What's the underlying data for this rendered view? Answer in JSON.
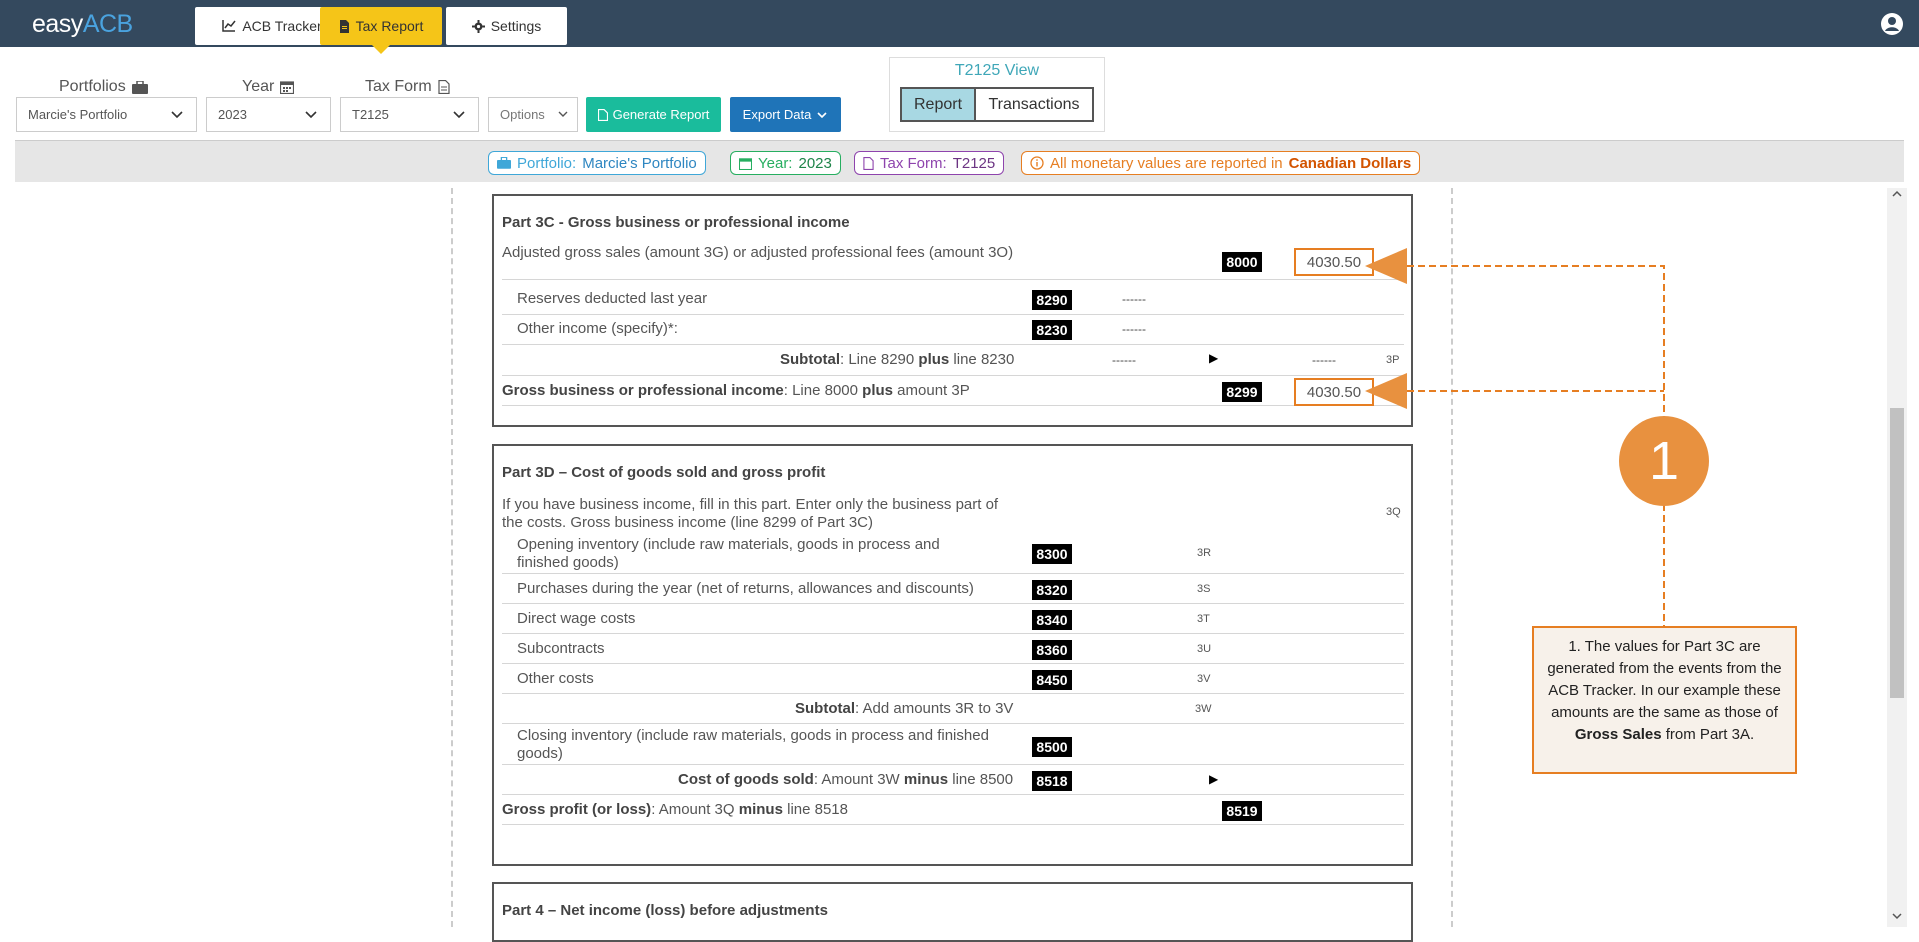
{
  "app": {
    "logo_easy": "easy",
    "logo_acb": "ACB"
  },
  "nav": {
    "tabs": [
      {
        "label": "ACB Tracker",
        "icon": "chart-line-icon"
      },
      {
        "label": "Tax Report",
        "icon": "document-icon",
        "active": true
      },
      {
        "label": "Settings",
        "icon": "gear-icon"
      }
    ]
  },
  "filters": {
    "portfolios_label": "Portfolios",
    "year_label": "Year",
    "taxform_label": "Tax Form",
    "portfolio_value": "Marcie's Portfolio",
    "year_value": "2023",
    "taxform_value": "T2125",
    "options_label": "Options",
    "generate_label": "Generate Report",
    "export_label": "Export Data"
  },
  "view": {
    "title": "T2125 View",
    "report_label": "Report",
    "transactions_label": "Transactions",
    "active": "Report"
  },
  "chips": {
    "portfolio_prefix": "Portfolio:",
    "portfolio_value": "Marcie's Portfolio",
    "year_prefix": "Year:",
    "year_value": "2023",
    "taxform_prefix": "Tax Form:",
    "taxform_value": "T2125",
    "currency_text": "All monetary values are reported in",
    "currency_value": "Canadian Dollars"
  },
  "part3c": {
    "title": "Part 3C - Gross business or professional income",
    "adj_text": "Adjusted gross sales (amount 3G) or adjusted professional fees (amount 3O)",
    "adj_code": "8000",
    "adj_value": "4030.50",
    "reserves_text": "Reserves deducted last year",
    "reserves_code": "8290",
    "reserves_val": "------",
    "other_text": "Other income (specify)*:",
    "other_code": "8230",
    "other_val": "------",
    "subtotal_bold": "Subtotal",
    "subtotal_text1": ": Line 8290",
    "subtotal_plus": "plus",
    "subtotal_text2": "line 8230",
    "subtotal_val1": "------",
    "subtotal_val2": "------",
    "subtotal_amt": "3P",
    "gross_bold": "Gross business or professional income",
    "gross_text1": ": Line 8000",
    "gross_plus": "plus",
    "gross_text2": "amount 3P",
    "gross_code": "8299",
    "gross_value": "4030.50"
  },
  "part3d": {
    "title": "Part 3D – Cost of goods sold and gross profit",
    "intro_text": "If you have business income, fill in this part. Enter only the business part of the costs. Gross business income (line 8299 of Part 3C)",
    "intro_amt": "3Q",
    "rows": [
      {
        "text": "Opening inventory (include raw materials, goods in process and finished goods)",
        "code": "8300",
        "amt": "3R"
      },
      {
        "text": "Purchases during the year (net of returns, allowances and discounts)",
        "code": "8320",
        "amt": "3S"
      },
      {
        "text": "Direct wage costs",
        "code": "8340",
        "amt": "3T"
      },
      {
        "text": "Subcontracts",
        "code": "8360",
        "amt": "3U"
      },
      {
        "text": "Other costs",
        "code": "8450",
        "amt": "3V"
      }
    ],
    "subtotal_bold": "Subtotal",
    "subtotal_text": ": Add amounts 3R to 3V",
    "subtotal_amt": "3W",
    "closing_text": "Closing inventory (include raw materials, goods in process and finished goods)",
    "closing_code": "8500",
    "cogs_bold": "Cost of goods sold",
    "cogs_text1": ": Amount 3W",
    "cogs_minus": "minus",
    "cogs_text2": "line 8500",
    "cogs_code": "8518",
    "gp_bold": "Gross profit (or loss)",
    "gp_text1": ": Amount 3Q",
    "gp_minus": "minus",
    "gp_text2": "line 8518",
    "gp_code": "8519"
  },
  "part4": {
    "title": "Part 4 – Net income (loss) before adjustments"
  },
  "callout": {
    "number": "1",
    "text1": "1. The values for Part 3C are generated from the events from the ACB Tracker. In our example these amounts are the same as those of",
    "bold": "Gross Sales",
    "text2": "from Part 3A."
  },
  "colors": {
    "topbar": "#34495e",
    "accent_yellow": "#f5c518",
    "callout_orange": "#e8913f",
    "generate_green": "#1abc9c",
    "export_blue": "#1f74b8"
  }
}
